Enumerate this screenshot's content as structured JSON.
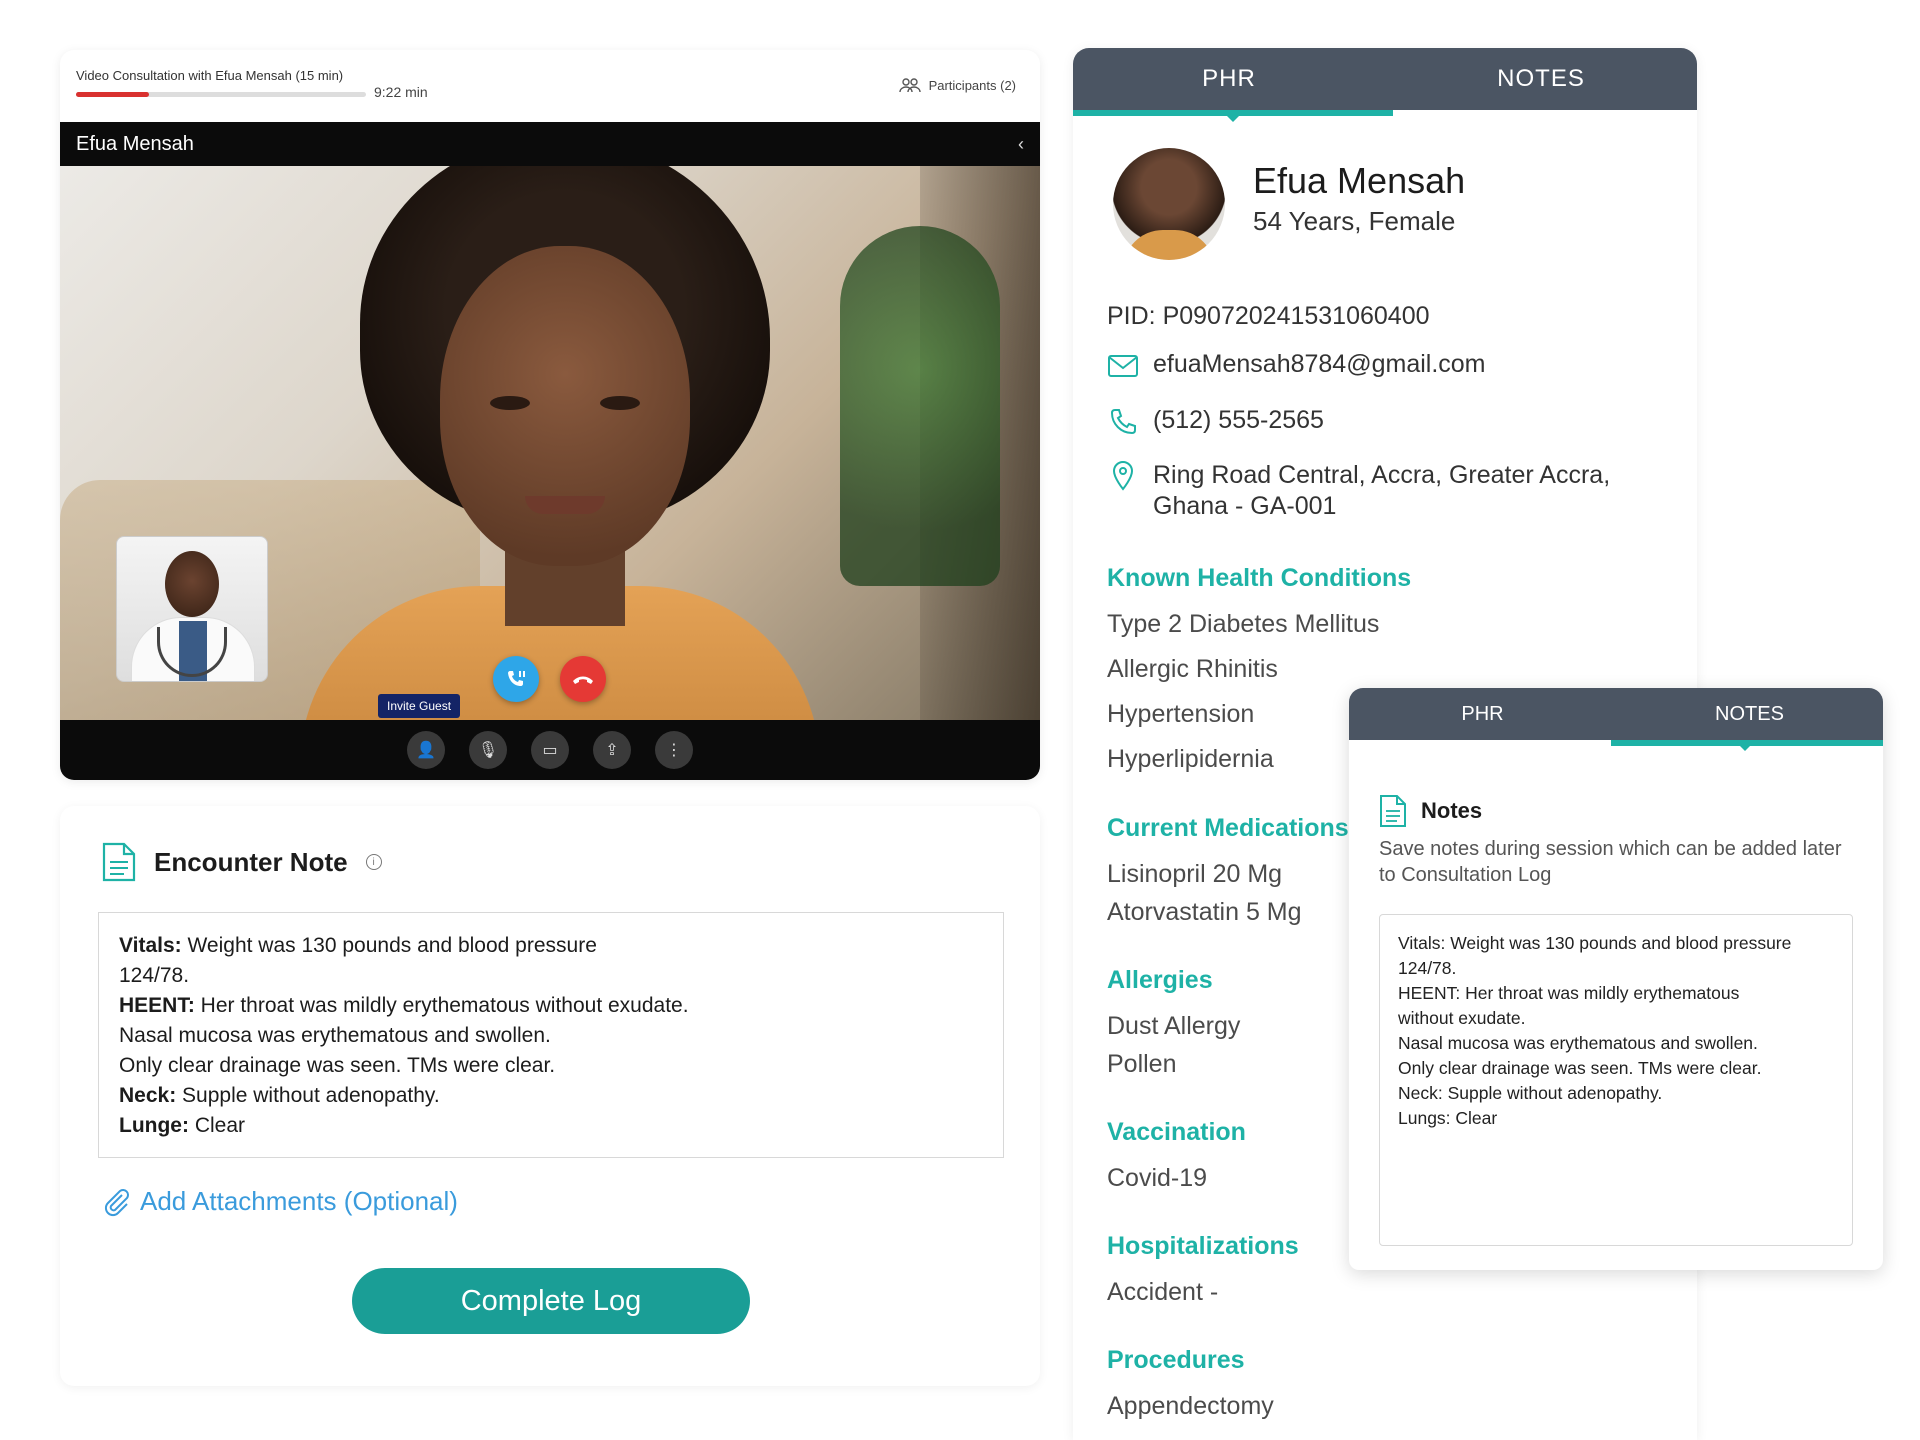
{
  "video": {
    "title": "Video Consultation with Efua Mensah (15 min)",
    "elapsed": "9:22 min",
    "progress_fraction": 0.25,
    "participants": "Participants (2)",
    "caller_name": "Efua Mensah",
    "invite_guest": "Invite Guest",
    "controls": [
      "user-icon",
      "mic-off-icon",
      "video-off-icon",
      "share-icon",
      "more-icon"
    ],
    "colors": {
      "progress": "#d9312f",
      "end_call": "#e53935",
      "mute_call": "#2ea6e8"
    }
  },
  "encounter": {
    "title": "Encounter Note",
    "lines": [
      {
        "label": "Vitals:",
        "text": " Weight was 130 pounds and blood pressure"
      },
      {
        "label": "",
        "text": "124/78."
      },
      {
        "label": "HEENT:",
        "text": " Her throat was mildly erythematous without exudate."
      },
      {
        "label": "",
        "text": "Nasal mucosa was erythematous and swollen."
      },
      {
        "label": "",
        "text": "Only clear drainage was seen. TMs were clear."
      },
      {
        "label": "Neck:",
        "text": " Supple without adenopathy."
      },
      {
        "label": "Lunge:",
        "text": " Clear"
      }
    ],
    "attach_label": "Add Attachments (Optional)",
    "complete_label": "Complete Log"
  },
  "phr": {
    "tabs": [
      "PHR",
      "NOTES"
    ],
    "active_tab": "PHR",
    "name": "Efua Mensah",
    "meta": "54 Years, Female",
    "pid": "PID: P090720241531060400",
    "email": "efuaMensah8784@gmail.com",
    "phone": "(512) 555-2565",
    "address_line1": "Ring Road Central, Accra, Greater Accra,",
    "address_line2": "Ghana - GA-001",
    "sections": {
      "conditions_title": "Known Health Conditions",
      "conditions": [
        "Type 2 Diabetes Mellitus",
        "Allergic Rhinitis",
        "Hypertension",
        "Hyperlipidernia"
      ],
      "meds_title": "Current Medications",
      "meds": [
        "Lisinopril 20 Mg",
        "Atorvastatin 5 Mg"
      ],
      "allergies_title": "Allergies",
      "allergies": [
        "Dust Allergy",
        "Pollen"
      ],
      "vaccination_title": "Vaccination",
      "vaccination": [
        "Covid-19"
      ],
      "hosp_title": "Hospitalizations",
      "hosp": [
        "Accident -"
      ],
      "procedures_title": "Procedures",
      "procedures": [
        "Appendectomy"
      ]
    },
    "colors": {
      "accent": "#1eb2a6",
      "tab_bg": "#4b5563"
    }
  },
  "notes": {
    "tabs": [
      "PHR",
      "NOTES"
    ],
    "active_tab": "NOTES",
    "title": "Notes",
    "description": "Save notes during session which can be added later to Consultation Log",
    "body_lines": [
      "Vitals: Weight was 130 pounds and blood pressure",
      "124/78.",
      "HEENT: Her throat was mildly erythematous",
      "without exudate.",
      "Nasal mucosa was erythematous and swollen.",
      "Only clear drainage was seen. TMs were clear.",
      "Neck: Supple without adenopathy.",
      "Lungs: Clear"
    ]
  }
}
